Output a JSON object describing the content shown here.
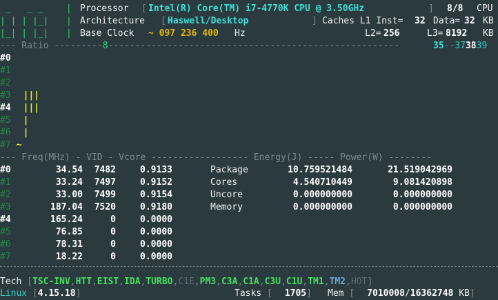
{
  "header": {
    "logo_lines": [
      " _   _ _",
      "| | | |_|",
      "|_| | |_|"
    ],
    "processor_label": "Processor",
    "processor_value": "Intel(R) Core(TM) i7-4770K CPU @ 3.50GHz",
    "cpu_count": "8/8",
    "cpu_label": "CPU",
    "architecture_label": "Architecture",
    "architecture_value": "Haswell/Desktop",
    "caches_label": "Caches L1 Inst=",
    "l1_inst": "32",
    "data_label": "Data=",
    "l1_data": "32",
    "kb": "KB",
    "base_clock_label": "Base Clock",
    "base_clock_value": "~ 097 236 400",
    "hz": "Hz",
    "l2_label": "L2=",
    "l2": "256",
    "l3_label": "L3=",
    "l3": "8192",
    "kb2": "KB"
  },
  "ratio": {
    "title": "--- Ratio ---------",
    "mark_8": "8",
    "mark_35": "35",
    "mark_37": "37",
    "mark_38": "38",
    "mark_39": "39",
    "rows": [
      {
        "id": "#0",
        "bar": ""
      },
      {
        "id": "#1",
        "bar": ""
      },
      {
        "id": "#2",
        "bar": ""
      },
      {
        "id": "#3",
        "bar": "|||"
      },
      {
        "id": "#4",
        "bar": "|||"
      },
      {
        "id": "#5",
        "bar": "|"
      },
      {
        "id": "#6",
        "bar": "|"
      },
      {
        "id": "#7",
        "bar": "~"
      }
    ]
  },
  "table": {
    "header_text": "--- Freq(MHz) - VID - Vcore ------------------ Energy(J) ----- Power(W) --------",
    "cores": [
      {
        "id": "#0",
        "freq": "34.54",
        "vid": "7482",
        "vcore": "0.9133"
      },
      {
        "id": "#1",
        "freq": "33.24",
        "vid": "7497",
        "vcore": "0.9152"
      },
      {
        "id": "#2",
        "freq": "33.00",
        "vid": "7499",
        "vcore": "0.9154"
      },
      {
        "id": "#3",
        "freq": "187.04",
        "vid": "7520",
        "vcore": "0.9180"
      },
      {
        "id": "#4",
        "freq": "165.24",
        "vid": "0",
        "vcore": "0.0000"
      },
      {
        "id": "#5",
        "freq": "76.85",
        "vid": "0",
        "vcore": "0.0000"
      },
      {
        "id": "#6",
        "freq": "78.31",
        "vid": "0",
        "vcore": "0.0000"
      },
      {
        "id": "#7",
        "freq": "18.22",
        "vid": "0",
        "vcore": "0.0000"
      }
    ],
    "energy": [
      {
        "label": "Package",
        "energy": "10.759521484",
        "power": "21.519042969"
      },
      {
        "label": "Cores",
        "energy": "4.540710449",
        "power": "9.081420898"
      },
      {
        "label": "Uncore",
        "energy": "0.000000000",
        "power": "0.000000000"
      },
      {
        "label": "Memory",
        "energy": "0.000000000",
        "power": "0.000000000"
      }
    ]
  },
  "tech": {
    "label": "Tech",
    "flags": [
      {
        "name": "TSC-INV",
        "state": "on"
      },
      {
        "name": "HTT",
        "state": "on"
      },
      {
        "name": "EIST",
        "state": "on"
      },
      {
        "name": "IDA",
        "state": "on"
      },
      {
        "name": "TURBO",
        "state": "on"
      },
      {
        "name": "C1E",
        "state": "off"
      },
      {
        "name": "PM3",
        "state": "on"
      },
      {
        "name": "C3A",
        "state": "on"
      },
      {
        "name": "C1A",
        "state": "on"
      },
      {
        "name": "C3U",
        "state": "on"
      },
      {
        "name": "C1U",
        "state": "on"
      },
      {
        "name": "TM1",
        "state": "on"
      },
      {
        "name": "TM2",
        "state": "blue"
      },
      {
        "name": "HOT",
        "state": "off"
      }
    ]
  },
  "status": {
    "os": "Linux",
    "kernel": "4.15.18",
    "tasks_label": "Tasks",
    "tasks": "1705",
    "mem_label": "Mem",
    "mem_used": "7010008",
    "mem_total": "16362748",
    "mem_unit": "KB"
  },
  "colors": {
    "background": "#2b3a3f",
    "bar": "#f2f228",
    "green": "#2bd46a",
    "cyan": "#2ed1c7"
  }
}
